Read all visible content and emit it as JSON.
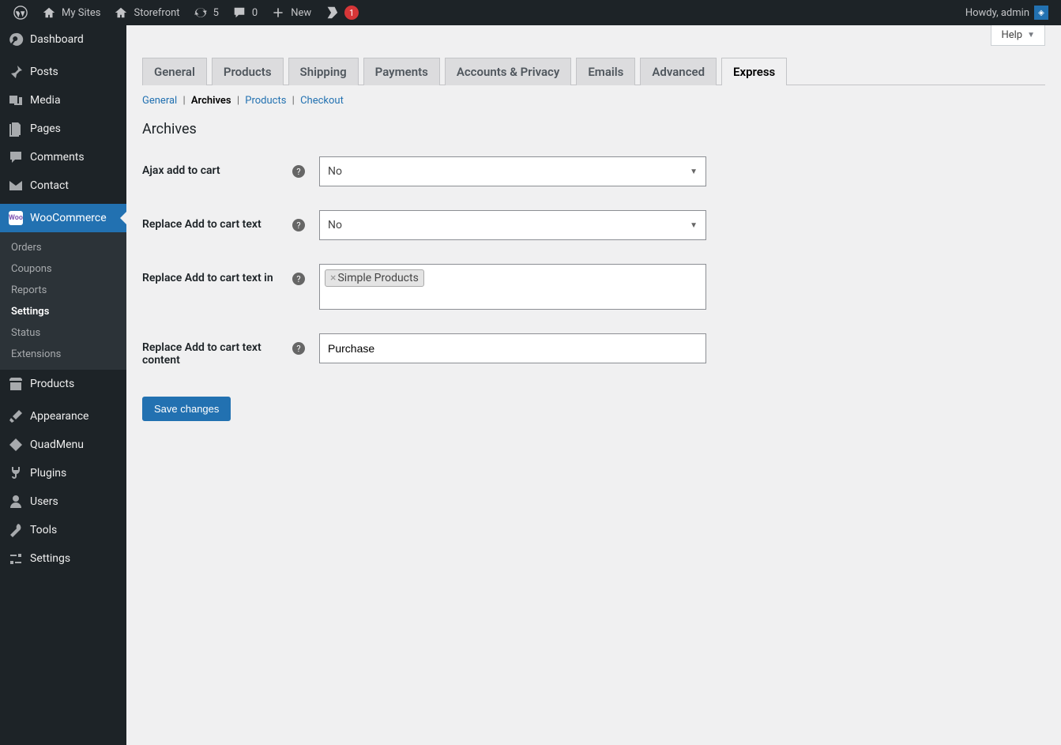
{
  "adminbar": {
    "mysites": "My Sites",
    "sitename": "Storefront",
    "updates_count": "5",
    "comments_count": "0",
    "new": "New",
    "yoast_badge": "1",
    "howdy": "Howdy, admin"
  },
  "sidebar": {
    "dashboard": "Dashboard",
    "posts": "Posts",
    "media": "Media",
    "pages": "Pages",
    "comments": "Comments",
    "contact": "Contact",
    "woocommerce": "WooCommerce",
    "woo_sub": {
      "orders": "Orders",
      "coupons": "Coupons",
      "reports": "Reports",
      "settings": "Settings",
      "status": "Status",
      "extensions": "Extensions"
    },
    "products": "Products",
    "appearance": "Appearance",
    "quadmenu": "QuadMenu",
    "plugins": "Plugins",
    "users": "Users",
    "tools": "Tools",
    "settings": "Settings"
  },
  "help": "Help",
  "tabs": {
    "general": "General",
    "products": "Products",
    "shipping": "Shipping",
    "payments": "Payments",
    "accounts": "Accounts & Privacy",
    "emails": "Emails",
    "advanced": "Advanced",
    "express": "Express"
  },
  "subnav": {
    "general": "General",
    "archives": "Archives",
    "products": "Products",
    "checkout": "Checkout"
  },
  "section_title": "Archives",
  "fields": {
    "ajax": {
      "label": "Ajax add to cart",
      "value": "No"
    },
    "replace_text": {
      "label": "Replace Add to cart text",
      "value": "No"
    },
    "replace_in": {
      "label": "Replace Add to cart text in",
      "chip": "Simple Products"
    },
    "replace_content": {
      "label": "Replace Add to cart text content",
      "value": "Purchase"
    }
  },
  "save": "Save changes"
}
